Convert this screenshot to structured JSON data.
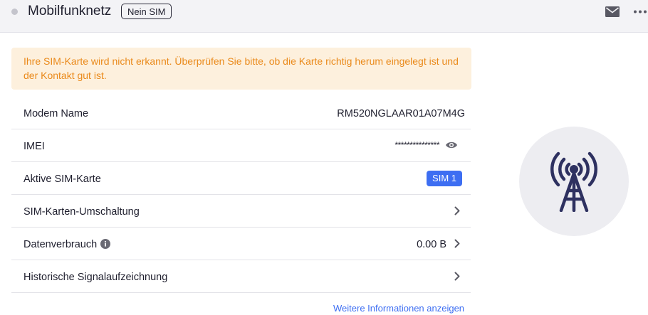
{
  "header": {
    "title": "Mobilfunknetz",
    "sim_status": "Nein SIM",
    "icons": [
      "status-dot",
      "mail-icon",
      "more-icon"
    ]
  },
  "warning": {
    "text": "Ihre SIM-Karte wird nicht erkannt. Überprüfen Sie bitte, ob die Karte richtig herum eingelegt ist und der Kontakt gut ist."
  },
  "rows": {
    "modem": {
      "label": "Modem Name",
      "value": "RM520NGLAAR01A07M4G"
    },
    "imei": {
      "label": "IMEI",
      "value": "***************"
    },
    "active_sim": {
      "label": "Aktive SIM-Karte",
      "value": "SIM 1"
    },
    "sim_switch": {
      "label": "SIM-Karten-Umschaltung"
    },
    "data_usage": {
      "label": "Datenverbrauch",
      "value": "0.00 B"
    },
    "signal_history": {
      "label": "Historische Signalaufzeichnung"
    }
  },
  "footer": {
    "more_info": "Weitere Informationen anzeigen"
  },
  "colors": {
    "accent": "#3d6ef2",
    "warning_text": "#ea8a1b",
    "warning_bg": "#fdf0dd",
    "tower": "#2e3160"
  }
}
